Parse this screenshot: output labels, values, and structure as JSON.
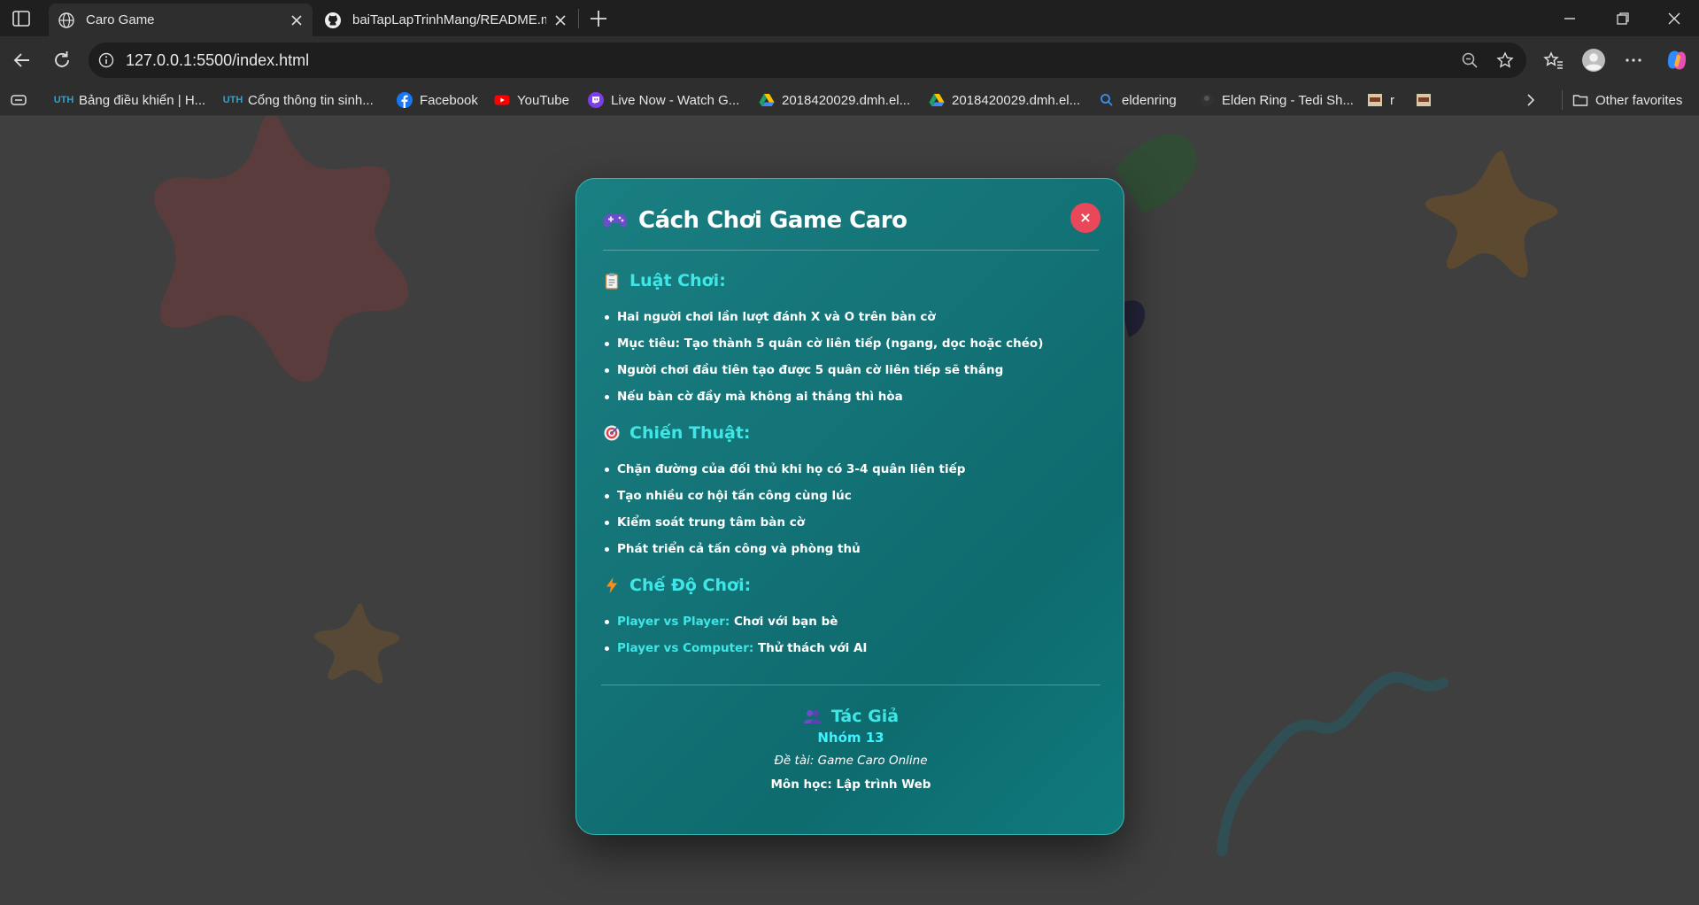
{
  "browser": {
    "tabs": [
      {
        "title": "Caro Game",
        "active": true
      },
      {
        "title": "baiTapLapTrinhMang/README.md",
        "active": false
      }
    ],
    "url": "127.0.0.1:5500/index.html",
    "bookmarks": [
      {
        "label": "Bảng điều khiển | H...",
        "icon": "uth-logo-icon"
      },
      {
        "label": "Cổng thông tin sinh...",
        "icon": "uth-logo-icon"
      },
      {
        "label": "Facebook",
        "icon": "facebook-icon"
      },
      {
        "label": "YouTube",
        "icon": "youtube-icon"
      },
      {
        "label": "Live Now - Watch G...",
        "icon": "twitch-icon"
      },
      {
        "label": "2018420029.dmh.el...",
        "icon": "google-drive-icon"
      },
      {
        "label": "2018420029.dmh.el...",
        "icon": "google-drive-icon"
      },
      {
        "label": "eldenring",
        "icon": "search-icon"
      },
      {
        "label": "Elden Ring - Tedi Sh...",
        "icon": "page-icon"
      },
      {
        "label": "r",
        "icon": "image-thumbnail-icon"
      }
    ],
    "other_favorites": "Other favorites"
  },
  "modal": {
    "title": "Cách Chơi Game Caro",
    "close_label": "×",
    "sections": [
      {
        "title": "Luật Chơi:",
        "icon": "clipboard-icon",
        "items": [
          "Hai người chơi lần lượt đánh X và O trên bàn cờ",
          "Mục tiêu: Tạo thành 5 quân cờ liên tiếp (ngang, dọc hoặc chéo)",
          "Người chơi đầu tiên tạo được 5 quân cờ liên tiếp sẽ thắng",
          "Nếu bàn cờ đầy mà không ai thắng thì hòa"
        ]
      },
      {
        "title": "Chiến Thuật:",
        "icon": "target-icon",
        "items": [
          "Chặn đường của đối thủ khi họ có 3-4 quân liên tiếp",
          "Tạo nhiều cơ hội tấn công cùng lúc",
          "Kiểm soát trung tâm bàn cờ",
          "Phát triển cả tấn công và phòng thủ"
        ]
      },
      {
        "title": "Chế Độ Chơi:",
        "icon": "lightning-icon",
        "modes": [
          {
            "name": "Player vs Player:",
            "desc": "Chơi với bạn bè"
          },
          {
            "name": "Player vs Computer:",
            "desc": "Thử thách với AI"
          }
        ]
      }
    ],
    "author": {
      "title": "Tác Giả",
      "group": "Nhóm 13",
      "topic": "Đề tài: Game Caro Online",
      "subject": "Môn học: Lập trình Web"
    }
  },
  "colors": {
    "modal_bg": "#137276",
    "accent": "#3fe6e6",
    "close_button": "#e8485a"
  }
}
